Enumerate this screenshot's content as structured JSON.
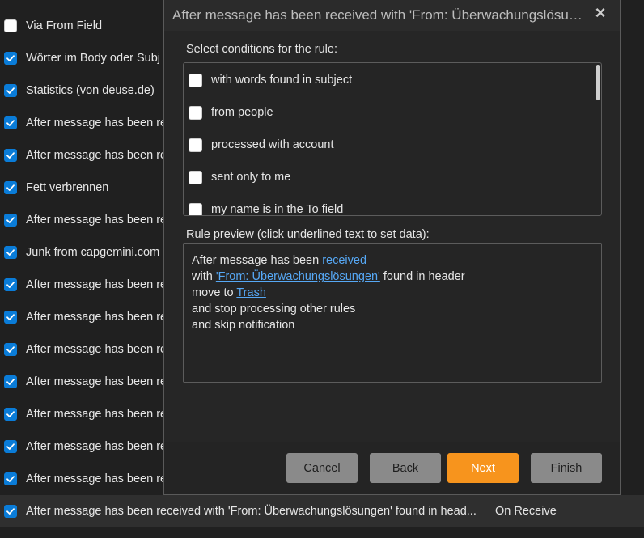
{
  "rules": [
    {
      "name": "Via From Field",
      "enabled": false
    },
    {
      "name": "Wörter im Body oder Subj",
      "enabled": true
    },
    {
      "name": "Statistics (von deuse.de)",
      "enabled": true
    },
    {
      "name": "After message has been re",
      "enabled": true
    },
    {
      "name": "After message has been re",
      "enabled": true
    },
    {
      "name": "Fett verbrennen",
      "enabled": true
    },
    {
      "name": "After message has been re",
      "enabled": true
    },
    {
      "name": "Junk from capgemini.com",
      "enabled": true
    },
    {
      "name": "After message has been re",
      "enabled": true
    },
    {
      "name": "After message has been re",
      "enabled": true
    },
    {
      "name": "After message has been re",
      "enabled": true
    },
    {
      "name": "After message has been re",
      "enabled": true
    },
    {
      "name": "After message has been re",
      "enabled": true
    },
    {
      "name": "After message has been re",
      "enabled": true
    },
    {
      "name": "After message has been re",
      "enabled": true
    },
    {
      "name": "After message has been received with 'From: Überwachungslösungen' found in head...",
      "enabled": true,
      "trigger": "On Receive",
      "selected": true
    }
  ],
  "dialog": {
    "title": "After message has been received with 'From: Überwachungslösungen' found in header",
    "close_icon": "×",
    "conditions_label": "Select conditions for the rule:",
    "conditions": [
      {
        "label": "with words found in subject",
        "checked": false
      },
      {
        "label": "from people",
        "checked": false
      },
      {
        "label": "processed with account",
        "checked": false
      },
      {
        "label": "sent only to me",
        "checked": false
      },
      {
        "label": "my name is in the To field",
        "checked": false
      }
    ],
    "preview_label": "Rule preview (click underlined text to set data):",
    "preview": {
      "line1_prefix": "After message has been ",
      "line1_link": "received",
      "line2_prefix": "with ",
      "line2_link": "'From: Überwachungslösungen'",
      "line2_suffix": " found in header",
      "line3_prefix": "move to ",
      "line3_link": "Trash",
      "line4": "and stop processing other rules",
      "line5": "and skip notification"
    },
    "buttons": {
      "cancel": "Cancel",
      "back": "Back",
      "next": "Next",
      "finish": "Finish"
    },
    "colors": {
      "accent": "#f7941d",
      "link": "#56a8f5",
      "checkbox_on": "#0a7cd8"
    }
  }
}
